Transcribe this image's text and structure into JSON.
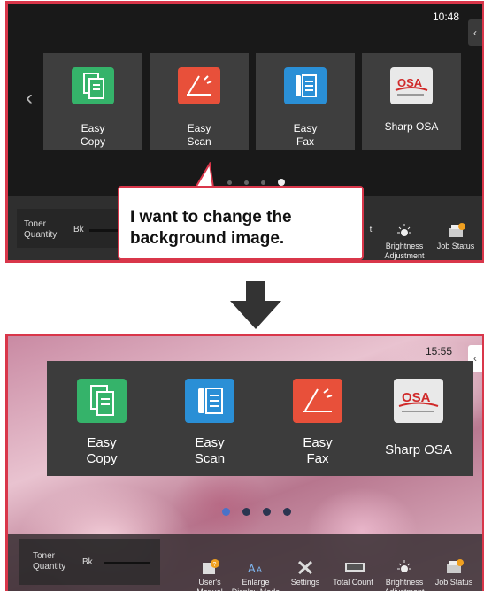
{
  "top_screen": {
    "clock": "10:48",
    "side_tab_icon": "chevron-left-icon",
    "tiles": [
      {
        "label": "Easy\nCopy",
        "icon": "copy-icon",
        "color": "#35b36a"
      },
      {
        "label": "Easy\nScan",
        "icon": "scan-icon",
        "color": "#e8503a"
      },
      {
        "label": "Easy\nFax",
        "icon": "fax-icon",
        "color": "#2a8fd6"
      },
      {
        "label": "Sharp OSA",
        "icon": "osa-logo-icon",
        "color": "#e9e9e9"
      }
    ],
    "pages": 4,
    "active_page": 4,
    "taskbar": {
      "toner_label": "Toner\nQuantity",
      "toner_color": "Bk",
      "partial_label": "t",
      "brightness_label": "Brightness\nAdjustment",
      "job_status_label": "Job Status"
    }
  },
  "callout": {
    "text": "I want to change the\nbackground image."
  },
  "bottom_screen": {
    "clock": "15:55",
    "tiles": [
      {
        "label": "Easy\nCopy",
        "icon": "copy-icon",
        "color": "#35b36a"
      },
      {
        "label": "Easy\nScan",
        "icon": "scan-icon",
        "color": "#2a8fd6"
      },
      {
        "label": "Easy\nFax",
        "icon": "fax-icon",
        "color": "#e8503a"
      },
      {
        "label": "Sharp OSA",
        "icon": "osa-logo-icon",
        "color": "#e9e9e9"
      }
    ],
    "pages": 4,
    "active_page": 1,
    "taskbar": {
      "toner_label": "Toner\nQuantity",
      "toner_color": "Bk",
      "items": [
        {
          "label": "User's\nManual",
          "icon": "manual-icon"
        },
        {
          "label": "Enlarge\nDisplay Mode",
          "icon": "enlarge-text-icon"
        },
        {
          "label": "Settings",
          "icon": "settings-icon"
        },
        {
          "label": "Total Count",
          "icon": "counter-icon"
        },
        {
          "label": "Brightness\nAdjustment",
          "icon": "brightness-icon"
        },
        {
          "label": "Job Status",
          "icon": "job-status-icon"
        }
      ]
    }
  }
}
